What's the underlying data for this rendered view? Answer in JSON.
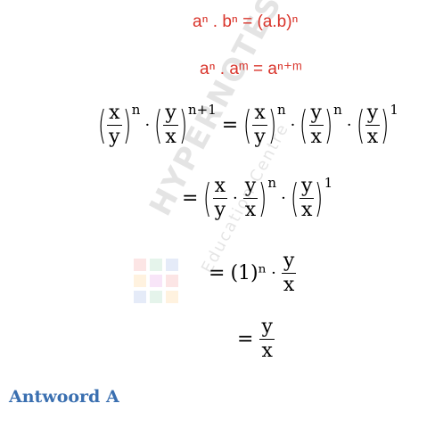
{
  "rules": [
    {
      "text": "aⁿ . bⁿ = (a.b)ⁿ"
    },
    {
      "text": "aⁿ . aᵐ = aⁿ⁺ᵐ"
    }
  ],
  "math": {
    "x": "x",
    "y": "y",
    "n": "n",
    "np1": "n+1",
    "one": "1",
    "eq": "=",
    "dot": "·",
    "onepow": "(1)ⁿ"
  },
  "answer": "Antwoord A",
  "watermark": {
    "title": "HYPERNOTES",
    "subtitle": "Education Centre"
  }
}
